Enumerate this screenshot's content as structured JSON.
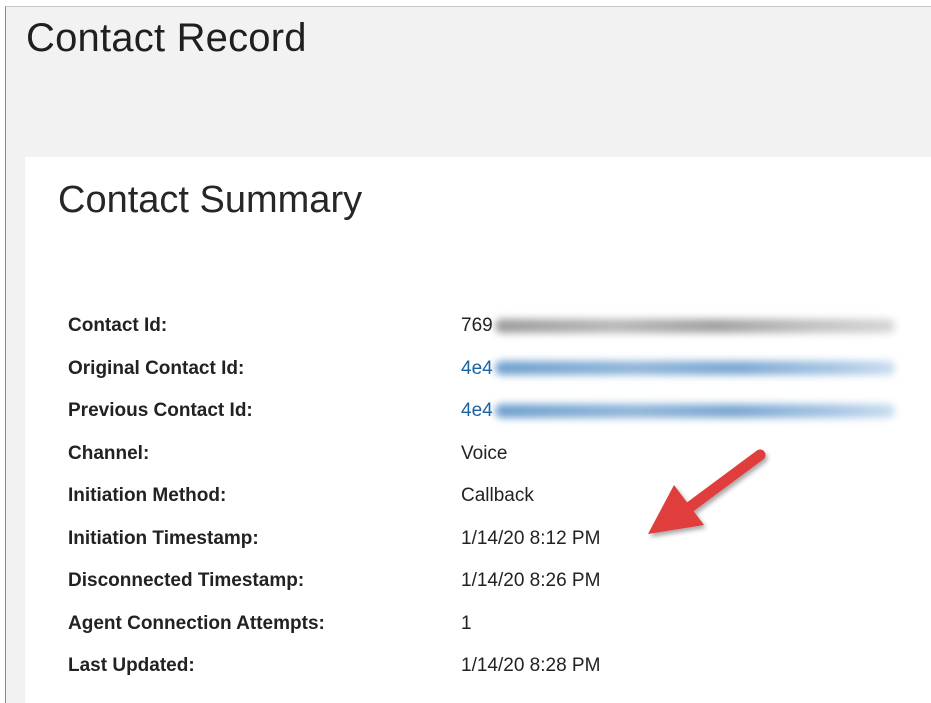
{
  "page": {
    "title": "Contact Record"
  },
  "summary": {
    "title": "Contact Summary",
    "rows": [
      {
        "label": "Contact Id:",
        "value": "769",
        "redacted": "gray",
        "link": false
      },
      {
        "label": "Original Contact Id:",
        "value": "4e4",
        "redacted": "blue",
        "link": true
      },
      {
        "label": "Previous Contact Id:",
        "value": "4e4",
        "redacted": "blue",
        "link": true
      },
      {
        "label": "Channel:",
        "value": "Voice",
        "link": false
      },
      {
        "label": "Initiation Method:",
        "value": "Callback",
        "link": false
      },
      {
        "label": "Initiation Timestamp:",
        "value": "1/14/20 8:12 PM",
        "link": false
      },
      {
        "label": "Disconnected Timestamp:",
        "value": "1/14/20 8:26 PM",
        "link": false
      },
      {
        "label": "Agent Connection Attempts:",
        "value": "1",
        "link": false
      },
      {
        "label": "Last Updated:",
        "value": "1/14/20 8:28 PM",
        "link": false
      }
    ]
  },
  "annotation": {
    "icon": "red-arrow-icon",
    "color": "#e03c3c",
    "points_to": "Initiation Timestamp"
  },
  "colors": {
    "link": "#1a63a5",
    "background": "#f2f2f2",
    "card": "#ffffff"
  }
}
